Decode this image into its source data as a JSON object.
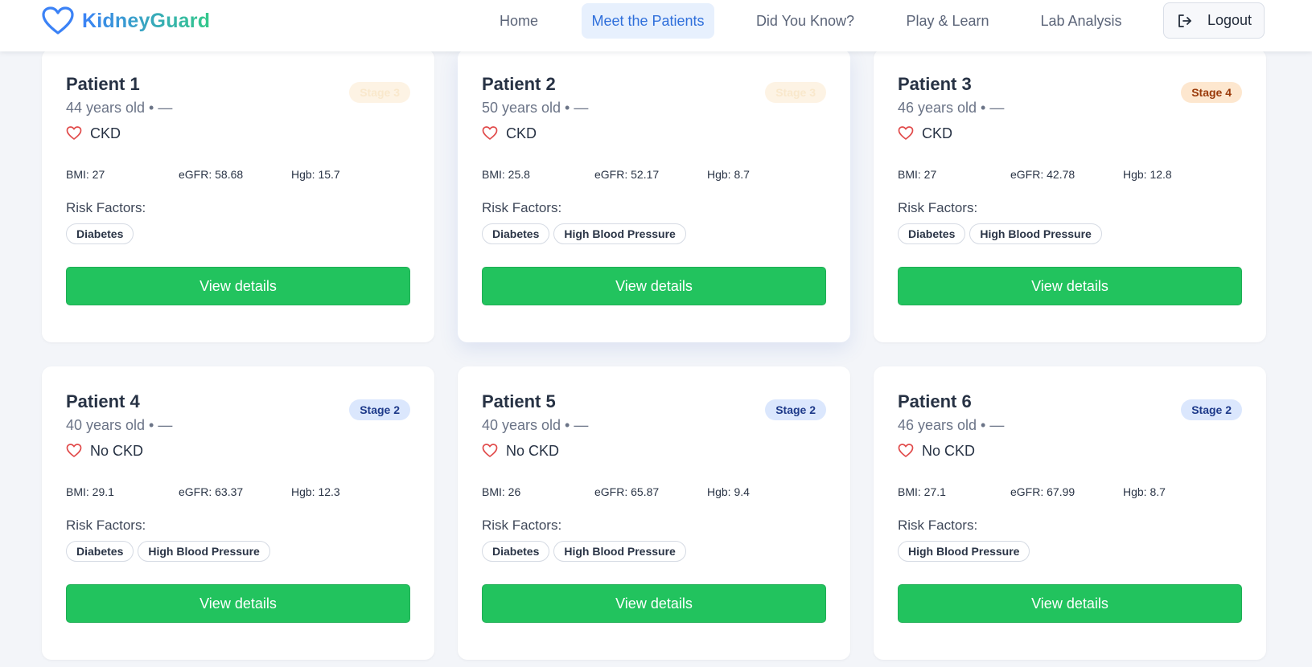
{
  "app": {
    "brand": "KidneyGuard"
  },
  "nav": {
    "items": [
      {
        "label": "Home"
      },
      {
        "label": "Meet the Patients"
      },
      {
        "label": "Did You Know?"
      },
      {
        "label": "Play & Learn"
      },
      {
        "label": "Lab Analysis"
      }
    ],
    "active_index": 1,
    "logout_label": "Logout"
  },
  "labels": {
    "risk_factors": "Risk Factors:",
    "view_details": "View details"
  },
  "patients": [
    {
      "name": "Patient 1",
      "subtitle": "44 years old • —",
      "diagnosis": "CKD",
      "stage": "Stage 3",
      "stage_style": "faded",
      "bmi": "BMI: 27",
      "egfr": "eGFR: 58.68",
      "hgb": "Hgb: 15.7",
      "risk_factors": [
        "Diabetes"
      ]
    },
    {
      "name": "Patient 2",
      "subtitle": "50 years old • —",
      "diagnosis": "CKD",
      "stage": "Stage 3",
      "stage_style": "faded",
      "bmi": "BMI: 25.8",
      "egfr": "eGFR: 52.17",
      "hgb": "Hgb: 8.7",
      "risk_factors": [
        "Diabetes",
        "High Blood Pressure"
      ]
    },
    {
      "name": "Patient 3",
      "subtitle": "46 years old • —",
      "diagnosis": "CKD",
      "stage": "Stage 4",
      "stage_style": "amber",
      "bmi": "BMI: 27",
      "egfr": "eGFR: 42.78",
      "hgb": "Hgb: 12.8",
      "risk_factors": [
        "Diabetes",
        "High Blood Pressure"
      ]
    },
    {
      "name": "Patient 4",
      "subtitle": "40 years old • —",
      "diagnosis": "No CKD",
      "stage": "Stage 2",
      "stage_style": "blue",
      "bmi": "BMI: 29.1",
      "egfr": "eGFR: 63.37",
      "hgb": "Hgb: 12.3",
      "risk_factors": [
        "Diabetes",
        "High Blood Pressure"
      ]
    },
    {
      "name": "Patient 5",
      "subtitle": "40 years old • —",
      "diagnosis": "No CKD",
      "stage": "Stage 2",
      "stage_style": "blue",
      "bmi": "BMI: 26",
      "egfr": "eGFR: 65.87",
      "hgb": "Hgb: 9.4",
      "risk_factors": [
        "Diabetes",
        "High Blood Pressure"
      ]
    },
    {
      "name": "Patient 6",
      "subtitle": "46 years old • —",
      "diagnosis": "No CKD",
      "stage": "Stage 2",
      "stage_style": "blue",
      "bmi": "BMI: 27.1",
      "egfr": "eGFR: 67.99",
      "hgb": "Hgb: 8.7",
      "risk_factors": [
        "High Blood Pressure"
      ]
    }
  ],
  "colors": {
    "primary_button": "#22c35e",
    "nav_active_bg": "#e7f0fd",
    "nav_active_text": "#2f6fdb",
    "heart_icon": "#e14b4b"
  },
  "icons": {
    "brand": "heart-outline-icon",
    "logout": "logout-arrow-icon",
    "diagnosis": "heart-outline-icon"
  }
}
